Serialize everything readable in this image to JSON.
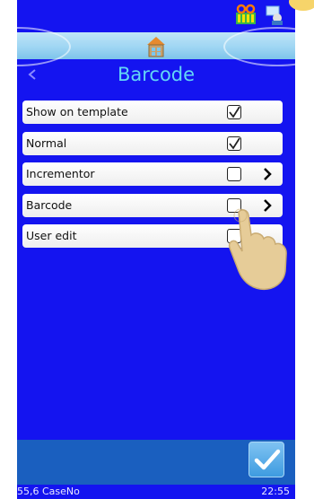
{
  "header": {
    "title": "Barcode"
  },
  "options": [
    {
      "label": "Show on template",
      "checked": true,
      "has_submenu": false
    },
    {
      "label": "Normal",
      "checked": true,
      "has_submenu": false
    },
    {
      "label": "Incrementor",
      "checked": false,
      "has_submenu": true
    },
    {
      "label": "Barcode",
      "checked": false,
      "has_submenu": true
    },
    {
      "label": "User edit",
      "checked": false,
      "has_submenu": false
    }
  ],
  "status_bar": {
    "left": "55,6 CaseNo",
    "right": "22:55"
  },
  "icons": {
    "top_left": "ribbon-cassette-icon",
    "top_right": "network-user-icon",
    "home": "home-icon",
    "back": "back-chevron-icon",
    "confirm": "checkmark-icon"
  },
  "colors": {
    "background": "#1414f0",
    "title": "#63d7f5",
    "footer": "#1a5fbf"
  }
}
